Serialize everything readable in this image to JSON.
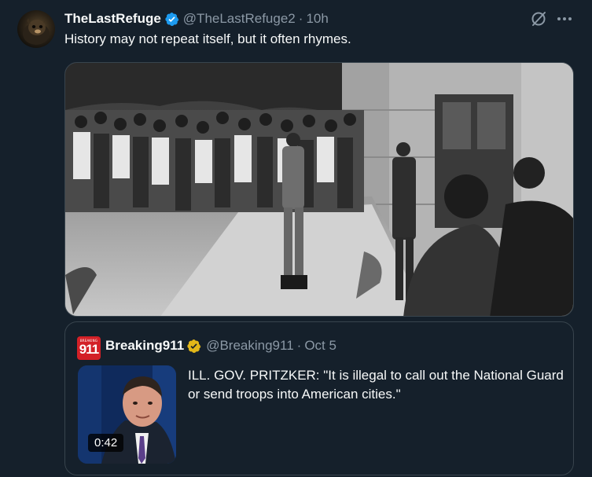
{
  "author": {
    "display_name": "TheLastRefuge",
    "handle": "@TheLastRefuge2",
    "separator": "·",
    "time": "10h"
  },
  "tweet": {
    "text": "History may not repeat itself, but it often rhymes."
  },
  "quoted": {
    "avatar_small_text": "BREAKING",
    "avatar_big_text": "911",
    "display_name": "Breaking911",
    "handle": "@Breaking911",
    "separator": "·",
    "date": "Oct 5",
    "text": "ILL. GOV. PRITZKER: \"It is illegal to call out the National Guard or send troops into American cities.\"",
    "video_duration": "0:42"
  },
  "colors": {
    "background": "#15202b",
    "verified_blue": "#1d9bf0",
    "verified_gold": "#e2b719",
    "secondary_text": "#8b98a5",
    "border": "#38444d",
    "brand_red": "#d32027"
  },
  "icons": {
    "verified": "verified-badge-icon",
    "gold_verified": "gold-verified-badge-icon",
    "grok": "grok-icon",
    "more": "more-icon"
  }
}
